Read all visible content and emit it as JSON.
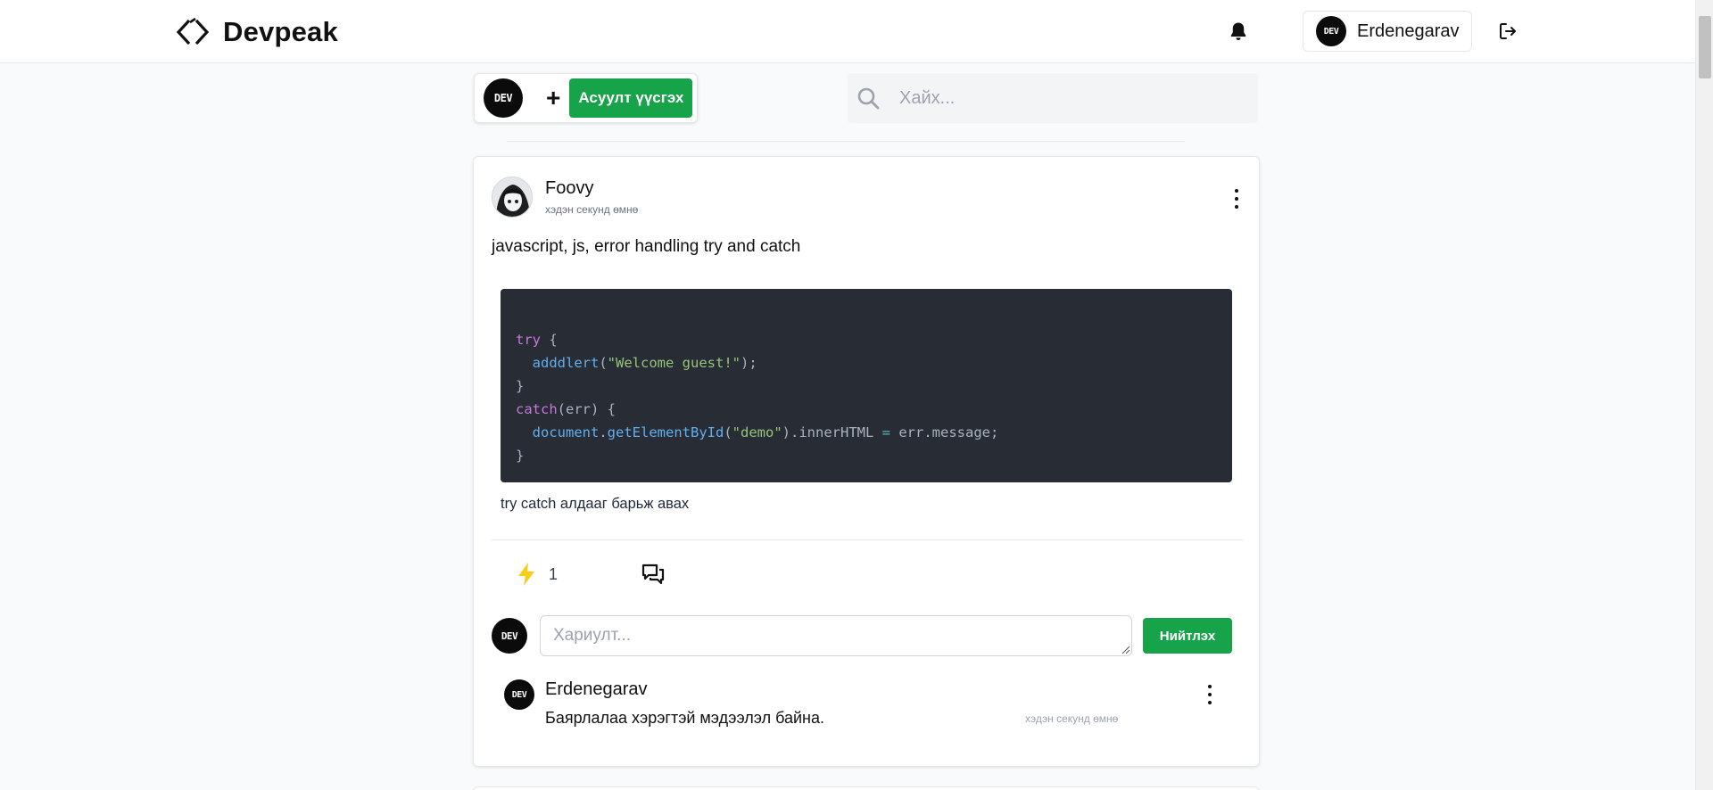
{
  "header": {
    "brand": "Devpeak",
    "user_name": "Erdenegarav",
    "avatar_text": "DEV"
  },
  "composer": {
    "avatar_text": "DEV",
    "plus": "+",
    "ask_label": "Асуулт үүсгэх"
  },
  "search": {
    "placeholder": "Хайх..."
  },
  "post": {
    "author": "Foovy",
    "time": "хэдэн секунд өмнө",
    "title": "javascript, js, error handling try and catch",
    "code_lines": [
      "try {",
      "  adddlert(\"Welcome guest!\");",
      "}",
      "catch(err) {",
      "  document.getElementById(\"demo\").innerHTML = err.message;",
      "}"
    ],
    "body": "try catch алдааг барьж авах",
    "reaction_count": "1",
    "reply": {
      "avatar_text": "DEV",
      "placeholder": "Хариулт...",
      "submit_label": "Нийтлэх"
    },
    "comments": [
      {
        "avatar_text": "DEV",
        "author": "Erdenegarav",
        "text": "Баярлалаа хэрэгтэй мэдээлэл байна.",
        "time": "хэдэн секунд өмнө"
      }
    ]
  },
  "colors": {
    "accent": "#16a34a",
    "code_bg": "#282c34",
    "reaction": "#facc15"
  },
  "icons": [
    "code-brackets-icon",
    "bell-icon",
    "logout-icon",
    "search-icon",
    "kebab-icon",
    "lightning-icon",
    "comments-icon"
  ]
}
